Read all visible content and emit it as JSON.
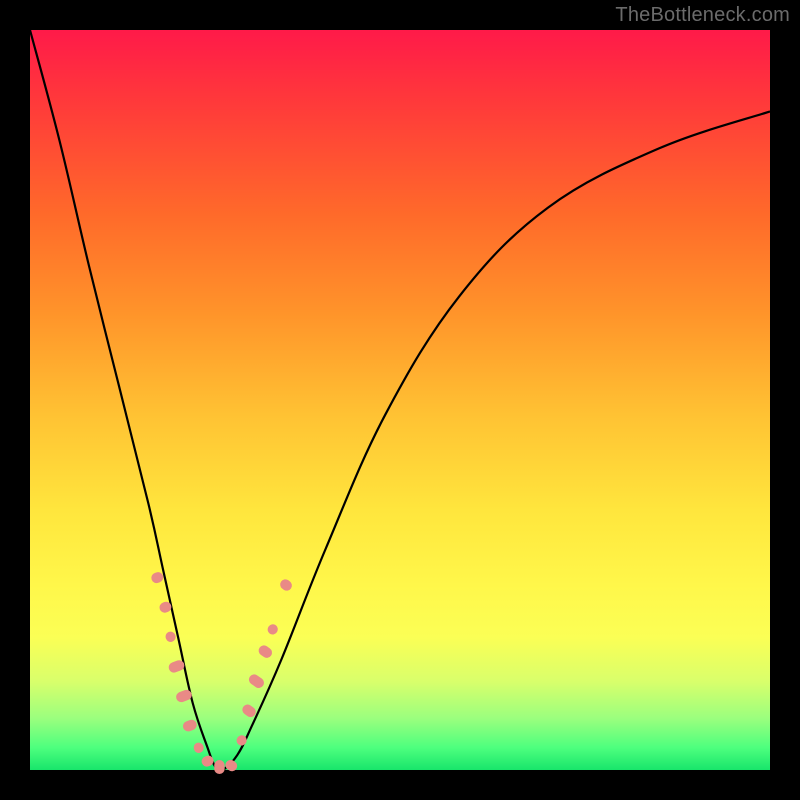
{
  "watermark": "TheBottleneck.com",
  "colors": {
    "frame": "#000000",
    "gradient_top": "#ff1a49",
    "gradient_bottom": "#18e56b",
    "curve_stroke": "#000000",
    "marker_fill": "#e98a86"
  },
  "chart_data": {
    "type": "line",
    "title": "",
    "xlabel": "",
    "ylabel": "",
    "xlim": [
      0,
      100
    ],
    "ylim": [
      0,
      100
    ],
    "grid": false,
    "legend": false,
    "series": [
      {
        "name": "bottleneck-curve",
        "x": [
          0,
          4,
          8,
          12,
          16,
          18,
          20,
          22,
          24,
          25,
          26,
          28,
          30,
          34,
          40,
          48,
          58,
          70,
          85,
          100
        ],
        "y": [
          100,
          85,
          68,
          52,
          36,
          27,
          18,
          9,
          3,
          0.5,
          0,
          2,
          6,
          15,
          30,
          48,
          64,
          76,
          84,
          89
        ]
      }
    ],
    "markers": [
      {
        "x": 17.2,
        "y": 26,
        "size": 12
      },
      {
        "x": 18.3,
        "y": 22,
        "size": 12
      },
      {
        "x": 19.0,
        "y": 18,
        "size": 10
      },
      {
        "x": 19.8,
        "y": 14,
        "size": 16
      },
      {
        "x": 20.8,
        "y": 10,
        "size": 16
      },
      {
        "x": 21.6,
        "y": 6,
        "size": 14
      },
      {
        "x": 22.8,
        "y": 3,
        "size": 10
      },
      {
        "x": 24.0,
        "y": 1.2,
        "size": 12
      },
      {
        "x": 25.6,
        "y": 0.4,
        "size": 14
      },
      {
        "x": 27.2,
        "y": 0.6,
        "size": 12
      },
      {
        "x": 28.6,
        "y": 4,
        "size": 10
      },
      {
        "x": 29.6,
        "y": 8,
        "size": 14
      },
      {
        "x": 30.6,
        "y": 12,
        "size": 16
      },
      {
        "x": 31.8,
        "y": 16,
        "size": 14
      },
      {
        "x": 32.8,
        "y": 19,
        "size": 10
      },
      {
        "x": 34.6,
        "y": 25,
        "size": 12
      }
    ]
  }
}
